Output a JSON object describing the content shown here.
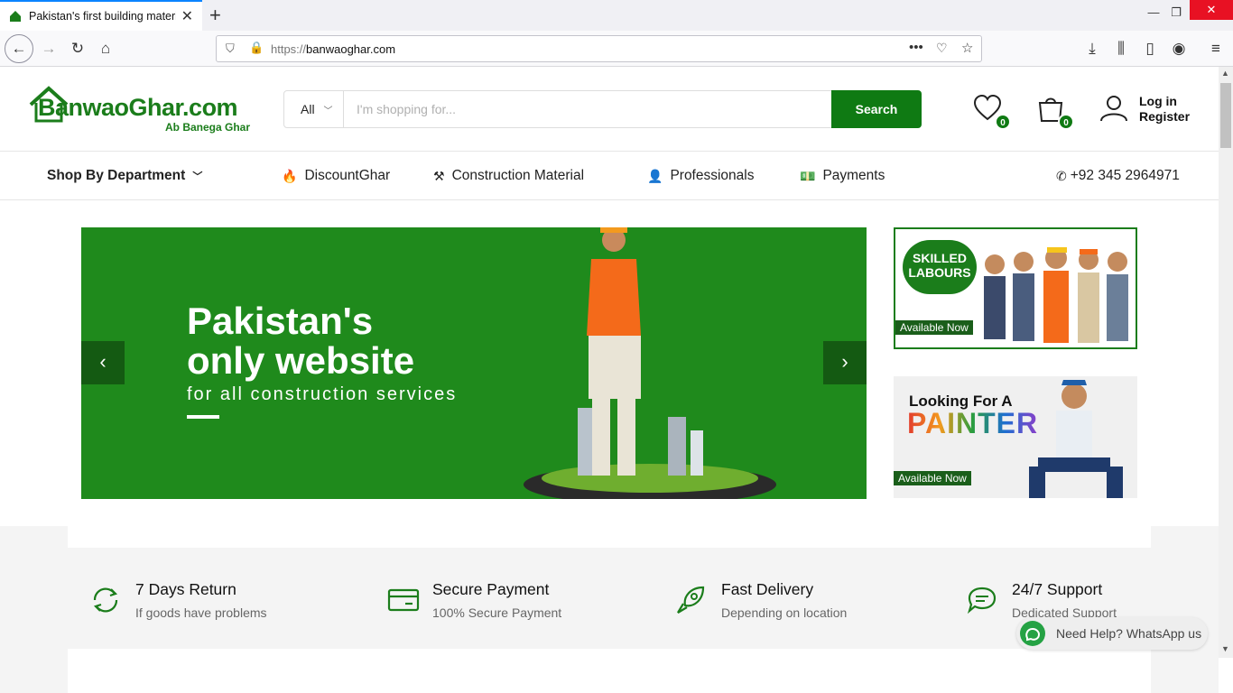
{
  "browser": {
    "tab_title": "Pakistan's first building materia",
    "tab_close": "✕",
    "new_tab": "+",
    "url_prefix": "https://",
    "url_host": "banwaoghar.com"
  },
  "header": {
    "logo_brand": "BanwaoGhar.com",
    "logo_tagline": "Ab Banega Ghar",
    "search_category": "All",
    "search_placeholder": "I'm shopping for...",
    "search_button": "Search",
    "wishlist_count": "0",
    "cart_count": "0",
    "login_label": "Log in",
    "register_label": "Register"
  },
  "nav": {
    "shop_by_department": "Shop By Department",
    "items": [
      {
        "label": "DiscountGhar",
        "icon": "flame-icon"
      },
      {
        "label": "Construction Material",
        "icon": "tools-icon"
      },
      {
        "label": "Professionals",
        "icon": "user-icon"
      },
      {
        "label": "Payments",
        "icon": "money-icon"
      }
    ],
    "phone": "+92 345 2964971"
  },
  "hero": {
    "heading_line1": "Pakistan's",
    "heading_line2": "only website",
    "subheading": "for all construction services",
    "bg_color": "#1f8a1c"
  },
  "banners": {
    "skilled_labours": "SKILLED LABOURS",
    "available_now_1": "Available Now",
    "painter_question": "Looking For A",
    "painter_word": "PAINTER",
    "available_now_2": "Available Now"
  },
  "features": [
    {
      "title": "7 Days Return",
      "subtitle": "If goods have problems",
      "icon": "refresh-icon"
    },
    {
      "title": "Secure Payment",
      "subtitle": "100% Secure Payment",
      "icon": "credit-card-icon"
    },
    {
      "title": "Fast Delivery",
      "subtitle": "Depending on location",
      "icon": "rocket-icon"
    },
    {
      "title": "24/7 Support",
      "subtitle": "Dedicated Support",
      "icon": "chat-icon"
    }
  ],
  "whatsapp": {
    "label": "Need Help? WhatsApp us"
  },
  "colors": {
    "brand_green": "#0f7a13",
    "browser_accent": "#0a84ff"
  }
}
